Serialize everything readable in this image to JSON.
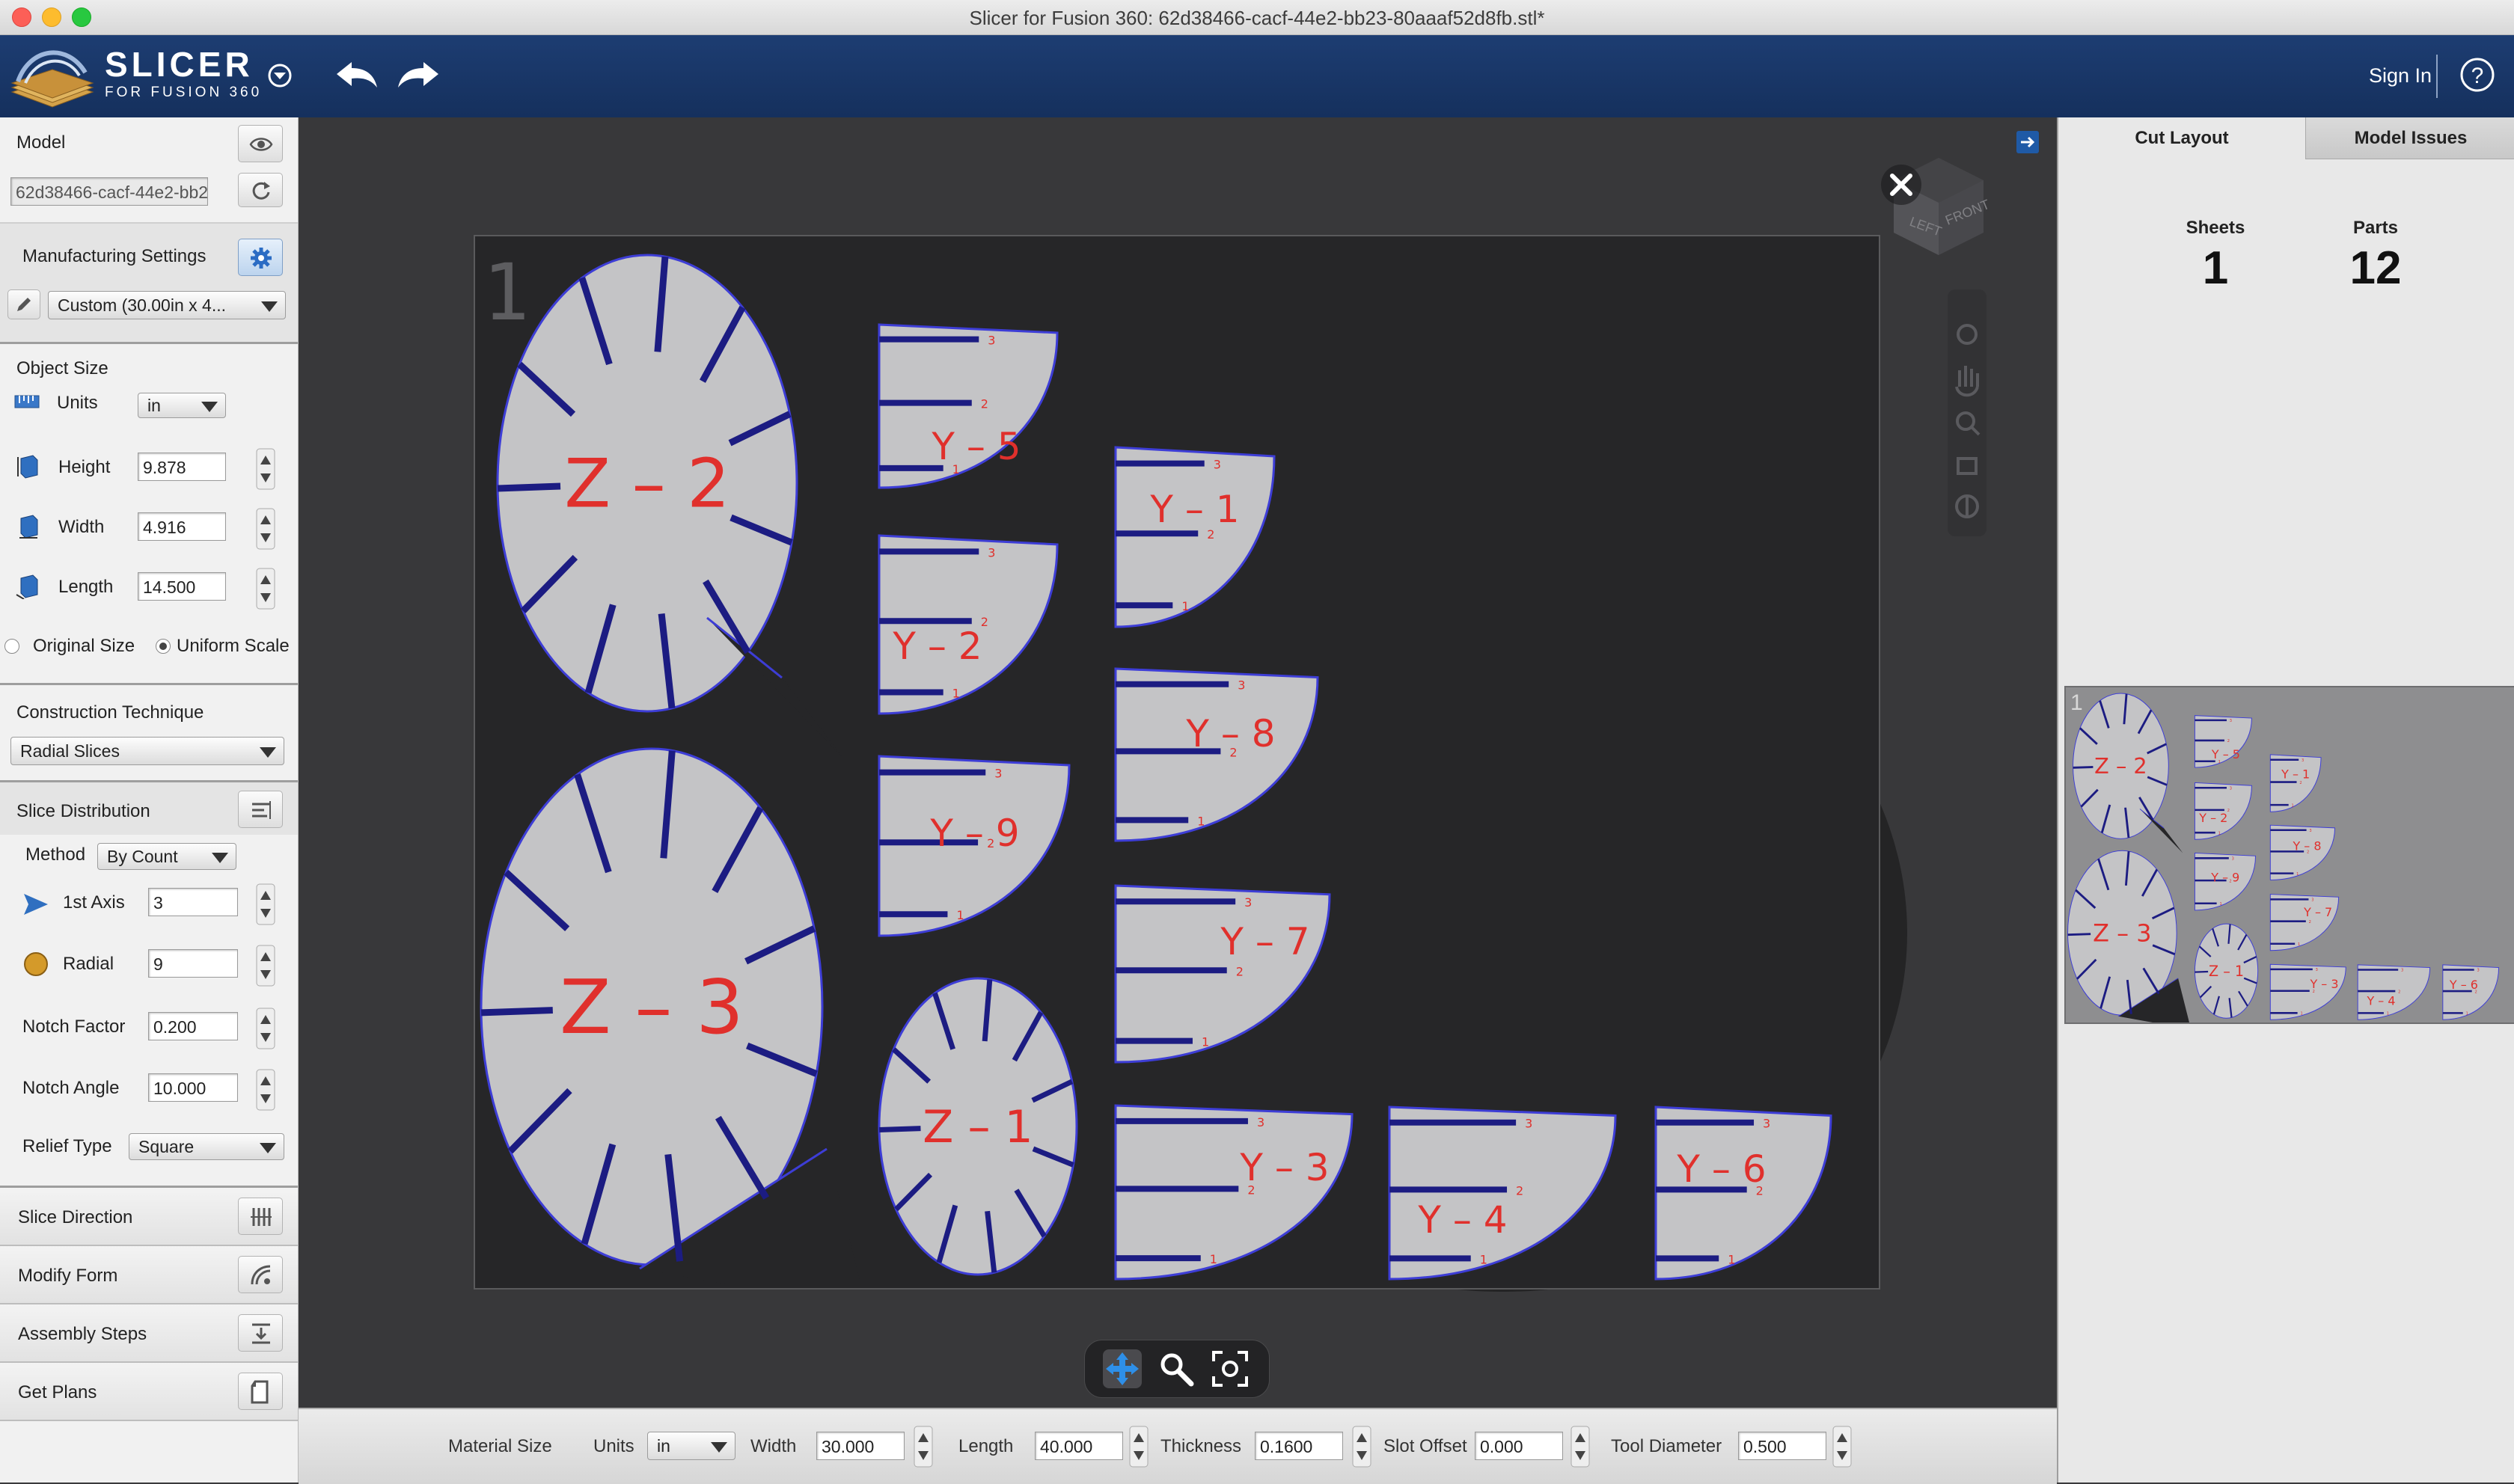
{
  "window": {
    "title": "Slicer for Fusion 360: 62d38466-cacf-44e2-bb23-80aaaf52d8fb.stl*"
  },
  "header": {
    "logo_line1": "SLICER",
    "logo_line2": "FOR FUSION 360",
    "sign_in": "Sign In",
    "help": "?"
  },
  "left_panel": {
    "model_label": "Model",
    "model_name": "62d38466-cacf-44e2-bb23-80aaaf52d8fb.stl",
    "manufacturing_label": "Manufacturing Settings",
    "manufacturing_preset": "Custom (30.00in x 4...",
    "object_size_label": "Object Size",
    "units_label": "Units",
    "units_value": "in",
    "height_label": "Height",
    "height_value": "9.878",
    "width_label": "Width",
    "width_value": "4.916",
    "length_label": "Length",
    "length_value": "14.500",
    "original_size_label": "Original Size",
    "uniform_scale_label": "Uniform Scale",
    "construction_label": "Construction Technique",
    "construction_value": "Radial Slices",
    "slice_distribution_label": "Slice Distribution",
    "method_label": "Method",
    "method_value": "By Count",
    "axis1_label": "1st Axis",
    "axis1_value": "3",
    "radial_label": "Radial",
    "radial_value": "9",
    "notch_factor_label": "Notch Factor",
    "notch_factor_value": "0.200",
    "notch_angle_label": "Notch Angle",
    "notch_angle_value": "10.000",
    "relief_type_label": "Relief Type",
    "relief_type_value": "Square",
    "slice_direction_label": "Slice Direction",
    "modify_form_label": "Modify Form",
    "assembly_steps_label": "Assembly Steps",
    "get_plans_label": "Get Plans"
  },
  "viewport": {
    "sheet_number": "1",
    "parts": [
      {
        "id": "Z-2",
        "label": "Z – 2"
      },
      {
        "id": "Z-3",
        "label": "Z – 3"
      },
      {
        "id": "Z-1",
        "label": "Z – 1"
      },
      {
        "id": "Y-5",
        "label": "Y – 5"
      },
      {
        "id": "Y-2",
        "label": "Y – 2"
      },
      {
        "id": "Y-9",
        "label": "Y – 9"
      },
      {
        "id": "Y-1",
        "label": "Y – 1"
      },
      {
        "id": "Y-8",
        "label": "Y – 8"
      },
      {
        "id": "Y-7",
        "label": "Y – 7"
      },
      {
        "id": "Y-3",
        "label": "Y – 3"
      },
      {
        "id": "Y-4",
        "label": "Y – 4"
      },
      {
        "id": "Y-6",
        "label": "Y – 6"
      }
    ],
    "notch_numbers": [
      "1",
      "2",
      "3"
    ]
  },
  "bottom_bar": {
    "material_size_label": "Material Size",
    "units_label": "Units",
    "units_value": "in",
    "width_label": "Width",
    "width_value": "30.000",
    "length_label": "Length",
    "length_value": "40.000",
    "thickness_label": "Thickness",
    "thickness_value": "0.1600",
    "slot_offset_label": "Slot Offset",
    "slot_offset_value": "0.000",
    "tool_diameter_label": "Tool Diameter",
    "tool_diameter_value": "0.500"
  },
  "right_panel": {
    "tab_cut_layout": "Cut Layout",
    "tab_model_issues": "Model Issues",
    "sheets_label": "Sheets",
    "sheets_value": "1",
    "parts_label": "Parts",
    "parts_value": "12",
    "thumbnail_number": "1"
  },
  "colors": {
    "header_blue": "#1b3a6d",
    "part_fill": "#c4c4c6",
    "part_outline": "#3d3dd6",
    "notch_blue": "#1c1c82",
    "label_red": "#e0302c"
  },
  "icons": {
    "eye": "eye-icon",
    "refresh": "refresh-icon",
    "gear": "gear-icon",
    "pencil": "pencil-icon",
    "close": "close-icon",
    "pan": "pan-icon",
    "zoom": "zoom-icon",
    "fit": "fit-view-icon"
  }
}
